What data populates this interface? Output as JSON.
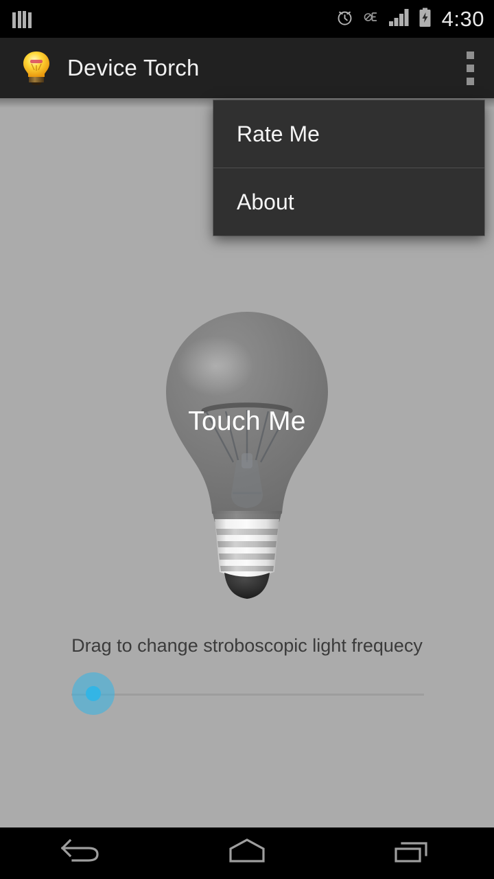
{
  "status_bar": {
    "time": "4:30",
    "left_icons": [
      {
        "name": "equalizer-notification-icon",
        "glyph": "bars"
      }
    ],
    "right_icons": [
      {
        "name": "alarm-clock-icon",
        "glyph": "alarm"
      },
      {
        "name": "no-data-edge-icon",
        "glyph": "slashed-E"
      },
      {
        "name": "signal-bars-icon",
        "glyph": "signal-4"
      },
      {
        "name": "battery-charging-icon",
        "glyph": "battery-bolt"
      }
    ]
  },
  "action_bar": {
    "app_icon": "lightbulb-icon",
    "title": "Device Torch",
    "overflow_icon": "overflow-menu-icon"
  },
  "overflow_menu": {
    "open": true,
    "items": [
      {
        "label": "Rate Me"
      },
      {
        "label": "About"
      }
    ]
  },
  "main": {
    "bulb": {
      "icon": "lightbulb-toggle-icon",
      "label": "Touch Me",
      "state": "off"
    },
    "slider": {
      "hint": "Drag to change stroboscopic light frequecy",
      "value": 0,
      "min": 0,
      "max": 100
    }
  },
  "nav_bar": {
    "buttons": [
      {
        "name": "back-button",
        "icon": "back-arrow-icon"
      },
      {
        "name": "home-button",
        "icon": "home-icon"
      },
      {
        "name": "recents-button",
        "icon": "recents-icon"
      }
    ]
  },
  "colors": {
    "status_bar_bg": "#000000",
    "action_bar_bg": "#212121",
    "menu_bg": "#303030",
    "content_bg": "#ababab",
    "accent": "#33b5e5",
    "text_light": "#f2f2f2",
    "text_dark": "#3b3b3b"
  }
}
